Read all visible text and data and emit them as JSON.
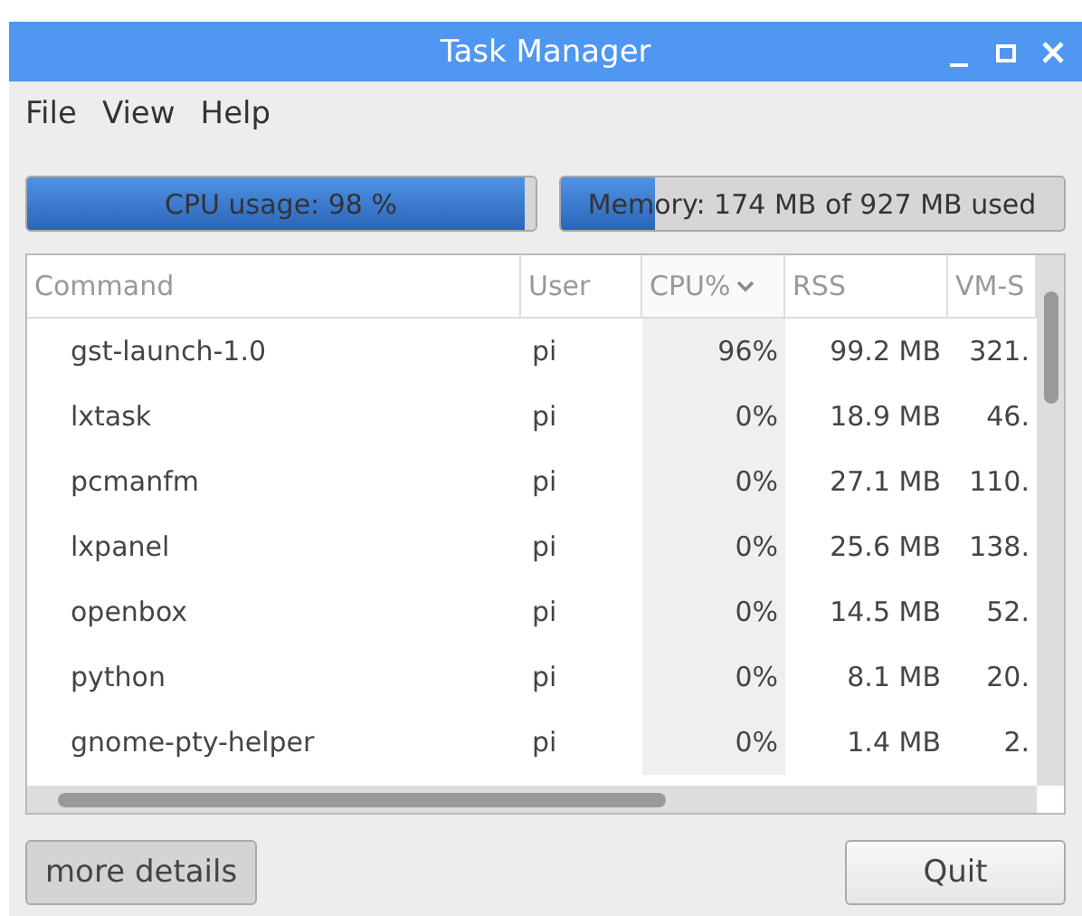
{
  "window": {
    "title": "Task Manager"
  },
  "menu": [
    "File",
    "View",
    "Help"
  ],
  "meters": [
    {
      "label": "CPU usage: 98 %",
      "level": 0.98
    },
    {
      "label": "Memory: 174 MB of 927 MB used",
      "level": 0.19
    }
  ],
  "table": {
    "columns": [
      {
        "label": "Command",
        "sorted": false
      },
      {
        "label": "User",
        "sorted": false
      },
      {
        "label": "CPU%",
        "sorted": true
      },
      {
        "label": "RSS",
        "sorted": false
      },
      {
        "label": "VM-S",
        "sorted": false
      }
    ],
    "rows": [
      [
        "gst-launch-1.0",
        "pi",
        "96%",
        "99.2 MB",
        "321."
      ],
      [
        "lxtask",
        "pi",
        "0%",
        "18.9 MB",
        "46."
      ],
      [
        "pcmanfm",
        "pi",
        "0%",
        "27.1 MB",
        "110."
      ],
      [
        "lxpanel",
        "pi",
        "0%",
        "25.6 MB",
        "138."
      ],
      [
        "openbox",
        "pi",
        "0%",
        "14.5 MB",
        "52."
      ],
      [
        "python",
        "pi",
        "0%",
        "8.1 MB",
        "20."
      ],
      [
        "gnome-pty-helper",
        "pi",
        "0%",
        "1.4 MB",
        "2."
      ]
    ]
  },
  "buttons": [
    {
      "label": "more details",
      "pressed": true
    },
    {
      "label": "Quit",
      "pressed": false
    }
  ]
}
